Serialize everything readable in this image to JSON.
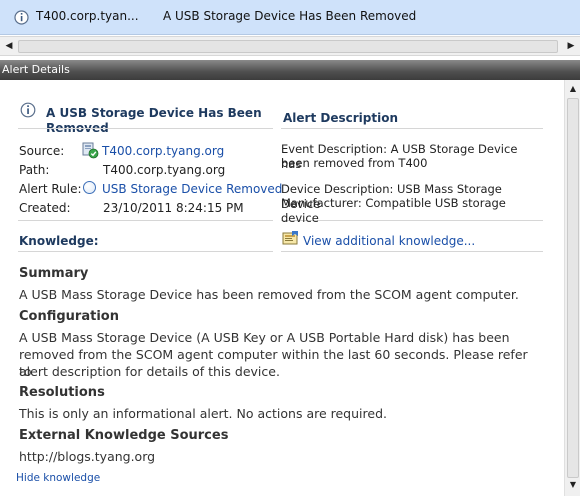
{
  "grid_row": {
    "source": "T400.corp.tyan...",
    "name": "A USB Storage Device Has Been Removed"
  },
  "details_bar": {
    "title": "Alert Details"
  },
  "alert": {
    "title": "A USB Storage Device Has Been Removed",
    "source_label": "Source:",
    "source_value": "T400.corp.tyang.org",
    "path_label": "Path:",
    "path_value": "T400.corp.tyang.org",
    "rule_label": "Alert Rule:",
    "rule_value": "USB Storage Device Removed",
    "created_label": "Created:",
    "created_value": "23/10/2011 8:24:15 PM"
  },
  "description": {
    "heading": "Alert Description",
    "event_line1": "Event Description: A USB Storage Device has",
    "event_line2": "been removed from T400",
    "device_line1": "Device Description: USB Mass Storage Device",
    "device_line2": "Manufacturer: Compatible USB storage device"
  },
  "knowledge": {
    "label": "Knowledge:",
    "link": "View additional knowledge...",
    "summary_head": "Summary",
    "summary_text": "A USB Mass Storage Device has been removed from the SCOM agent computer.",
    "config_head": "Configuration",
    "config_line1": "A USB Mass Storage Device (A USB Key or A USB Portable Hard disk) has been",
    "config_line2": "removed from the SCOM agent computer within the last 60 seconds. Please refer to",
    "config_line3": "alert description for details of this device.",
    "resolutions_head": "Resolutions",
    "resolutions_text": "This is only an informational alert. No actions are required.",
    "external_head": "External Knowledge Sources",
    "external_text": "http://blogs.tyang.org",
    "hide_link": "Hide knowledge"
  },
  "colors": {
    "selection_row": "#cfe2fa",
    "link": "#1a4fa8",
    "heading": "#1e3a5f"
  },
  "icons": [
    "info-icon",
    "computer-health-icon",
    "rule-circle-icon",
    "knowledge-book-icon"
  ]
}
